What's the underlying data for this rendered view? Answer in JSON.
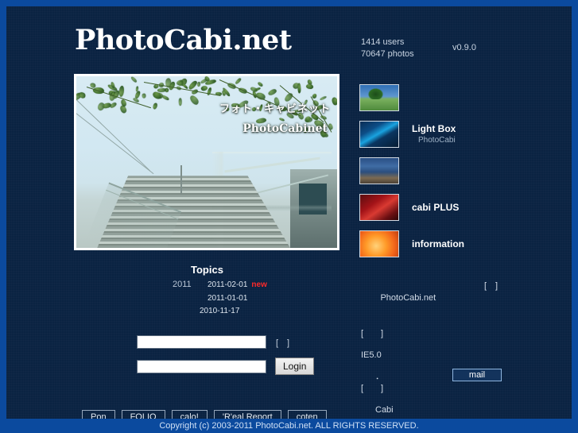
{
  "site": {
    "title": "PhotoCabi.net",
    "version": "v0.9.0",
    "users": "1414 users",
    "photos": "70647 photos"
  },
  "hero": {
    "overlay_jp": "フォト・キャビネット",
    "overlay_en": "PhotoCabinet"
  },
  "menu": [
    {
      "title": "",
      "sub": "",
      "thumb": "landscape-tree-thumb"
    },
    {
      "title": "Light Box",
      "sub": "PhotoCabi",
      "thumb": "blue-mountain-thumb"
    },
    {
      "title": "",
      "sub": "",
      "thumb": "night-landscape-thumb"
    },
    {
      "title": "cabi PLUS",
      "sub": "",
      "thumb": "red-abstract-thumb"
    },
    {
      "title": "information",
      "sub": "",
      "thumb": "orange-flower-thumb"
    }
  ],
  "topics": {
    "heading": "Topics",
    "year": "2011",
    "rows": [
      {
        "date": "2011-02-01",
        "badge": "new"
      },
      {
        "date": "2011-01-01",
        "badge": ""
      },
      {
        "date": "2010-11-17",
        "badge": ""
      }
    ]
  },
  "info": {
    "line1": "PhotoCabi.net",
    "line1_right": "[　]",
    "line2": "[　　]",
    "line3": "IE5.0",
    "line4": "．",
    "line5": "[　　]",
    "line6": "Cabi"
  },
  "login": {
    "user_value": "",
    "user_placeholder": "",
    "user_hint": "[　]",
    "pass_value": "",
    "pass_placeholder": "",
    "submit_label": "Login",
    "mail_label": "mail"
  },
  "links": [
    "Pon",
    "FOLIO",
    "calo!",
    "'R'eal Report",
    "coten"
  ],
  "footer": {
    "copyright": "Copyright (c) 2003-2011 PhotoCabi.net. ALL RIGHTS RESERVED."
  },
  "colors": {
    "outer_border": "#0b4a9e",
    "page_bg": "#0a2342",
    "accent_red": "#ff2a2a",
    "text": "#ffffff"
  }
}
